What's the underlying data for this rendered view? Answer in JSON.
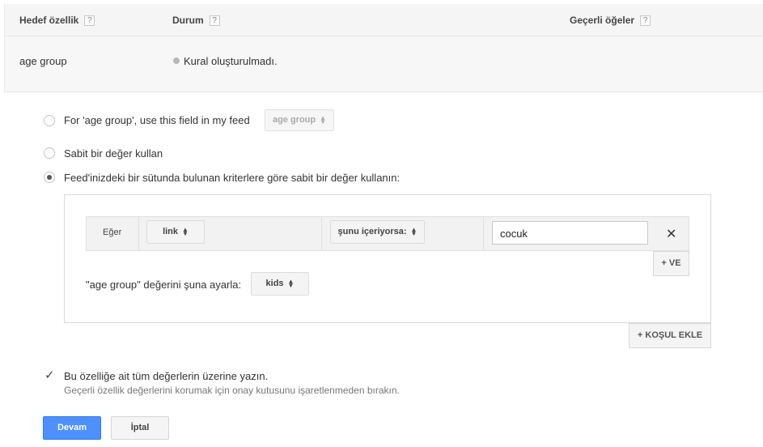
{
  "header": {
    "col_attribute": "Hedef özellik",
    "col_status": "Durum",
    "col_valid": "Geçerli öğeler",
    "help": "?"
  },
  "row": {
    "attribute": "age group",
    "status": "Kural oluşturulmadı."
  },
  "options": {
    "use_field_label": "For 'age group', use this field in my feed",
    "use_field_select": "age group",
    "static_value_label": "Sabit bir değer kullan",
    "criteria_label": "Feed'inizdeki bir sütunda bulunan kriterlere göre sabit bir değer kullanın:",
    "selected": "criteria"
  },
  "condition": {
    "if_label": "Eğer",
    "field_select": "link",
    "operator_select": "şunu içeriyorsa:",
    "value": "cocuk",
    "remove_symbol": "✕",
    "and_button": "+ VE"
  },
  "set_value": {
    "label": "\"age group\" değerini şuna ayarla:",
    "select": "kids"
  },
  "add_condition_button": "+ KOŞUL EKLE",
  "overwrite": {
    "checked": true,
    "label": "Bu özelliğe ait tüm değerlerin üzerine yazın.",
    "hint": "Geçerli özellik değerlerini korumak için onay kutusunu işaretlenmeden bırakın."
  },
  "buttons": {
    "continue": "Devam",
    "cancel": "İptal"
  }
}
